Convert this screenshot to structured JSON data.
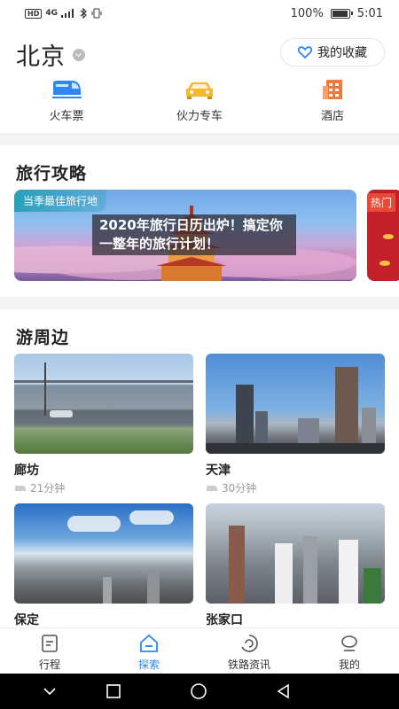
{
  "status_bar": {
    "left_badges": [
      "HD",
      "4G"
    ],
    "battery": "100%",
    "time": "5:01"
  },
  "header": {
    "city": "北京",
    "favorites_label": "我的收藏"
  },
  "quick_entries": [
    {
      "label": "火车票",
      "icon": "train-icon"
    },
    {
      "label": "伙力专车",
      "icon": "car-icon"
    },
    {
      "label": "酒店",
      "icon": "hotel-icon"
    }
  ],
  "travel_guide": {
    "title": "旅行攻略",
    "banner": {
      "tag": "当季最佳旅行地",
      "headline": "2020年旅行日历出炉！搞定你一整年的旅行计划！"
    },
    "banner2_tag": "热门"
  },
  "nearby": {
    "title": "游周边",
    "cards": [
      {
        "name": "廊坊",
        "duration": "21分钟"
      },
      {
        "name": "天津",
        "duration": "30分钟"
      },
      {
        "name": "保定",
        "duration": ""
      },
      {
        "name": "张家口",
        "duration": ""
      }
    ]
  },
  "bottom_nav": [
    {
      "label": "行程",
      "active": false
    },
    {
      "label": "探索",
      "active": true
    },
    {
      "label": "铁路资讯",
      "active": false
    },
    {
      "label": "我的",
      "active": false
    }
  ],
  "colors": {
    "accent": "#2f86f6",
    "train_icon": "#2f86f6",
    "car_icon": "#f4b931",
    "hotel_icon": "#f07a3c"
  }
}
